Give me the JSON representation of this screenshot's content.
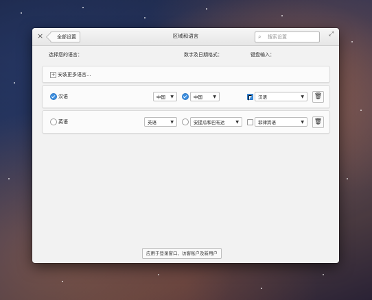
{
  "window": {
    "title": "区域和语言",
    "back_label": "全部设置",
    "close_icon": "×",
    "maximize_icon": "⤢"
  },
  "search": {
    "placeholder": "搜索设置"
  },
  "columns": {
    "language": "选择您的语言：",
    "formats": "数字及日期格式：",
    "input": "键盘输入："
  },
  "install_more": {
    "label": "安装更多语言..."
  },
  "languages": [
    {
      "name": "汉语",
      "selected": true,
      "region": "中国",
      "format_selected": true,
      "format": "中国",
      "input_checked": true,
      "input": "汉语"
    },
    {
      "name": "英语",
      "selected": false,
      "region": "英语",
      "format_selected": false,
      "format": "安提瓜和巴布达",
      "input_checked": false,
      "input": "菲律宾语"
    }
  ],
  "apply_button": "应用于登录窗口、访客账户及新用户",
  "colors": {
    "accent": "#3c8fe0",
    "window_bg": "#f2f2f2"
  }
}
